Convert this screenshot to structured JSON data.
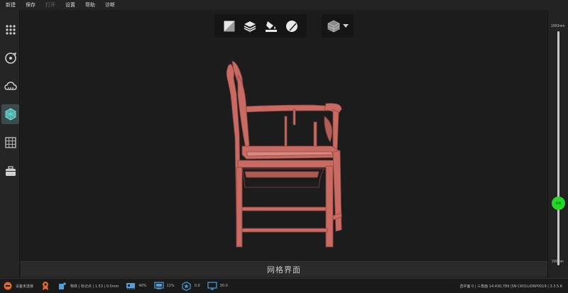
{
  "menu": {
    "items": [
      {
        "label": "新建",
        "enabled": true
      },
      {
        "label": "保存",
        "enabled": true
      },
      {
        "label": "打开",
        "enabled": false
      },
      {
        "label": "设置",
        "enabled": true
      },
      {
        "label": "帮助",
        "enabled": true
      },
      {
        "label": "诊断",
        "enabled": true
      }
    ]
  },
  "left_toolbar": {
    "tools": [
      {
        "name": "dot-grid-icon",
        "active": false
      },
      {
        "name": "rotate-target-icon",
        "active": false
      },
      {
        "name": "cloud-icon",
        "active": false
      },
      {
        "name": "mesh-cube-icon",
        "active": true
      },
      {
        "name": "grid-panel-icon",
        "active": false
      },
      {
        "name": "toolbox-icon",
        "active": false
      }
    ]
  },
  "view_toolbar": {
    "buttons": [
      "front-view-icon",
      "layers-icon",
      "paint-fill-icon",
      "sphere-shade-icon"
    ],
    "mode_icon": "display-mode-icon"
  },
  "slider": {
    "top_label": "1000mm",
    "bottom_label": "200mm",
    "thumb_label": "600",
    "value_fraction": 0.25
  },
  "caption": {
    "text": "网格界面"
  },
  "status": {
    "device": "设备未连接",
    "object_info": "物体 | 标记点 | 1.53 | 0.5mm",
    "memory": "40%",
    "gpu": "11%",
    "star": "0.0",
    "other": "30.0",
    "selection": "选中面 0 | 三角面 14,430,789 |SN CK01LIDRP0019 | 3.3.5.6"
  },
  "colors": {
    "chair": "#c96a63",
    "slider_thumb": "#25d825",
    "accent_active": "#3b4a4a"
  }
}
